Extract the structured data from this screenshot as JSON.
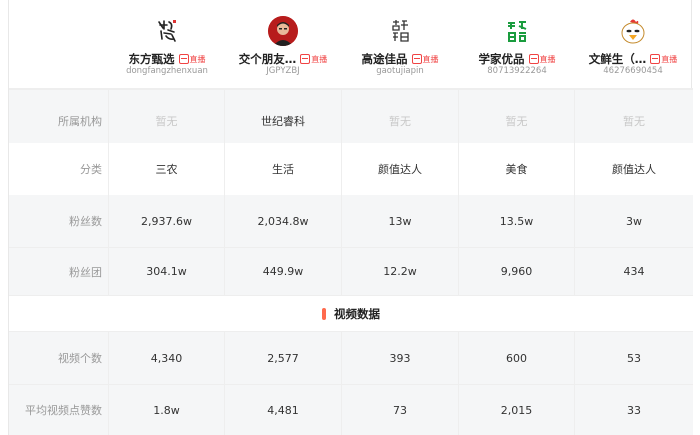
{
  "accounts": [
    {
      "name": "东方甄选",
      "id": "dongfangzhenxuan",
      "live": "直播",
      "avatar": "calligraphy-logo-icon"
    },
    {
      "name": "交个朋友…",
      "id": "JGPYZBJ",
      "live": "直播",
      "avatar": "person-photo-icon"
    },
    {
      "name": "高途佳品",
      "id": "gaotujiapin",
      "live": "直播",
      "avatar": "calligraphy-logo-icon"
    },
    {
      "name": "学家优品",
      "id": "80713922264",
      "live": "直播",
      "avatar": "green-text-logo-icon",
      "avatar_text": "学家\n优品"
    },
    {
      "name": "文鲜生（…",
      "id": "46276690454",
      "live": "直播",
      "avatar": "cartoon-chick-icon"
    }
  ],
  "rows": {
    "org": {
      "label": "所属机构",
      "values": [
        "暂无",
        "世纪睿科",
        "暂无",
        "暂无",
        "暂无"
      ]
    },
    "category": {
      "label": "分类",
      "values": [
        "三农",
        "生活",
        "颜值达人",
        "美食",
        "颜值达人"
      ]
    },
    "fans": {
      "label": "粉丝数",
      "values": [
        "2,937.6w",
        "2,034.8w",
        "13w",
        "13.5w",
        "3w"
      ]
    },
    "fan_group": {
      "label": "粉丝团",
      "values": [
        "304.1w",
        "449.9w",
        "12.2w",
        "9,960",
        "434"
      ]
    },
    "video_count": {
      "label": "视频个数",
      "values": [
        "4,340",
        "2,577",
        "393",
        "600",
        "53"
      ]
    },
    "avg_likes": {
      "label": "平均视频点赞数",
      "values": [
        "1.8w",
        "4,481",
        "73",
        "2,015",
        "33"
      ]
    }
  },
  "section": {
    "title": "视频数据"
  },
  "colors": {
    "accent": "#ff6a4d",
    "live": "#f04343",
    "muted": "#999999",
    "placeholder": "#c8c8c8",
    "row_gray": "#f5f6f7"
  }
}
